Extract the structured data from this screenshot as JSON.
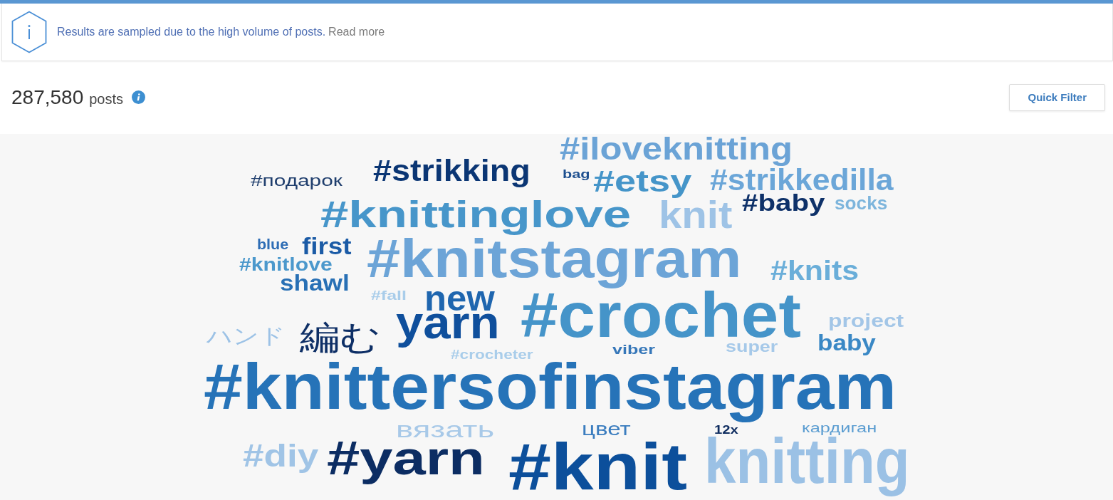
{
  "notice": {
    "message": "Results are sampled due to the high volume of posts.",
    "link": "Read more"
  },
  "summary": {
    "count": "287,580",
    "unit": "posts"
  },
  "quick_filter": {
    "label": "Quick Filter"
  },
  "word_cloud": {
    "words": [
      {
        "text": "#подарок",
        "color": "#1f3e6d"
      },
      {
        "text": "#strikking",
        "color": "#0b3674"
      },
      {
        "text": "#iloveknitting",
        "color": "#6ba3d6"
      },
      {
        "text": "bag",
        "color": "#1d4f8f"
      },
      {
        "text": "#etsy",
        "color": "#4595c9"
      },
      {
        "text": "#strikkedilla",
        "color": "#6ba6d8"
      },
      {
        "text": "#knittinglove",
        "color": "#4796ca"
      },
      {
        "text": "knit",
        "color": "#9ec3e6"
      },
      {
        "text": "#baby",
        "color": "#0e3169"
      },
      {
        "text": "socks",
        "color": "#7db5dc"
      },
      {
        "text": "blue",
        "color": "#2e6db5"
      },
      {
        "text": "first",
        "color": "#1b5ba6"
      },
      {
        "text": "#knitlove",
        "color": "#4b98cc"
      },
      {
        "text": "shawl",
        "color": "#2870b5"
      },
      {
        "text": "#knitstagram",
        "color": "#6ca4d7"
      },
      {
        "text": "#knits",
        "color": "#6aaed9"
      },
      {
        "text": "ハンド",
        "color": "#9cc2e6"
      },
      {
        "text": "編む",
        "color": "#0e2f66"
      },
      {
        "text": "#fall",
        "color": "#a9cdea"
      },
      {
        "text": "new",
        "color": "#1f66af"
      },
      {
        "text": "yarn",
        "color": "#0f4f9c"
      },
      {
        "text": "#crocheter",
        "color": "#a9cdea"
      },
      {
        "text": "#crochet",
        "color": "#4594c9"
      },
      {
        "text": "viber",
        "color": "#3677b9"
      },
      {
        "text": "super",
        "color": "#a6c9e9"
      },
      {
        "text": "project",
        "color": "#a3c6e7"
      },
      {
        "text": "baby",
        "color": "#3a88c5"
      },
      {
        "text": "#knittersofinstagram",
        "color": "#2673b8"
      },
      {
        "text": "вязать",
        "color": "#a8c9e8"
      },
      {
        "text": "цвет",
        "color": "#3b7dbf"
      },
      {
        "text": "12x",
        "color": "#0e2c5f"
      },
      {
        "text": "кардиган",
        "color": "#5b9dd1"
      },
      {
        "text": "#diy",
        "color": "#a0c4e6"
      },
      {
        "text": "#yarn",
        "color": "#0c2d63"
      },
      {
        "text": "#knit",
        "color": "#0c4f9b"
      },
      {
        "text": "knitting",
        "color": "#9bc1e5"
      }
    ]
  }
}
